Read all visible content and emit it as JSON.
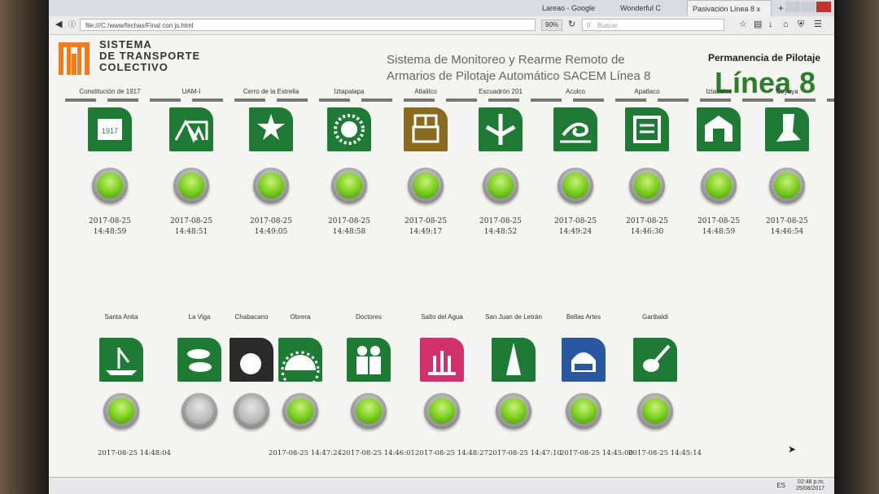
{
  "browser": {
    "tabs": [
      "Lareao - Google",
      "Wonderful C",
      "Pasivación Línea 8"
    ],
    "url": "file:///C:/www/fechas/Final con js.html",
    "zoom": "90%",
    "search_placeholder": "Buscar",
    "close_tab": "x",
    "new_tab": "+"
  },
  "header": {
    "brand_line1": "SISTEMA",
    "brand_line2": "DE TRANSPORTE",
    "brand_line3": "COLECTIVO",
    "title_line1": "Sistema de Monitoreo y Rearme Remoto de",
    "title_line2": "Armarios de Pilotaje Automático SACEM Línea 8",
    "perm_label": "Permanencia de Pilotaje",
    "line_label": "Línea 8"
  },
  "colors": {
    "green": "#1e7a34",
    "lamp_on": "#7dd020",
    "lamp_off": "#b8b8b8",
    "title": "#2e7d28"
  },
  "stations_top": [
    {
      "name": "Constitución de 1917",
      "date": "2017-08-25",
      "time": "14:48:59",
      "status": "on",
      "icon": "document-1917-icon"
    },
    {
      "name": "UAM-I",
      "date": "2017-08-25",
      "time": "14:48:51",
      "status": "on",
      "icon": "building-icon"
    },
    {
      "name": "Cerro de la Estrella",
      "date": "2017-08-25",
      "time": "14:49:05",
      "status": "on",
      "icon": "star-hill-icon"
    },
    {
      "name": "Iztapalapa",
      "date": "2017-08-25",
      "time": "14:48:58",
      "status": "on",
      "icon": "sun-icon"
    },
    {
      "name": "Atlalilco",
      "date": "2017-08-25",
      "time": "14:49:17",
      "status": "on",
      "icon": "well-icon"
    },
    {
      "name": "Escuadrón 201",
      "date": "2017-08-25",
      "time": "14:48:52",
      "status": "on",
      "icon": "plane-icon"
    },
    {
      "name": "Aculco",
      "date": "2017-08-25",
      "time": "14:49:24",
      "status": "on",
      "icon": "water-spiral-icon"
    },
    {
      "name": "Apatlaco",
      "date": "2017-08-25",
      "time": "14:46:30",
      "status": "on",
      "icon": "canal-icon"
    },
    {
      "name": "Iztacalco",
      "date": "2017-08-25",
      "time": "14:48:59",
      "status": "on",
      "icon": "temple-icon"
    },
    {
      "name": "Coyuya",
      "date": "2017-08-25",
      "time": "14:46:54",
      "status": "on",
      "icon": "foot-icon"
    }
  ],
  "stations_bottom": [
    {
      "name": "Santa Anita",
      "status": "on",
      "icon": "boat-icon"
    },
    {
      "name": "La Viga",
      "status": "off",
      "icon": "fish-icon"
    },
    {
      "name": "Chabacano",
      "status": "off",
      "icon": "apricot-icon"
    },
    {
      "name": "Obrera",
      "status": "on",
      "icon": "gear-sun-icon"
    },
    {
      "name": "Doctores",
      "status": "on",
      "icon": "doctors-icon"
    },
    {
      "name": "Salto del Agua",
      "status": "on",
      "icon": "fountain-icon"
    },
    {
      "name": "San Juan de Letrán",
      "status": "on",
      "icon": "tower-icon"
    },
    {
      "name": "Bellas Artes",
      "status": "on",
      "icon": "palace-icon"
    },
    {
      "name": "Garibaldi",
      "status": "on",
      "icon": "guitar-icon"
    }
  ],
  "bottom_timestamps": [
    "2017-08-25 14:48:04",
    "2017-08-25 14:47:24",
    "2017-08-25 14:46:01",
    "2017-08-25 14:48:27",
    "2017-08-25 14:47:10",
    "2017-08-25 14:45:00",
    "2017-08-25 14:45:14"
  ],
  "taskbar": {
    "lang": "ES",
    "time": "02:48 p.m.",
    "date": "25/08/2017"
  }
}
